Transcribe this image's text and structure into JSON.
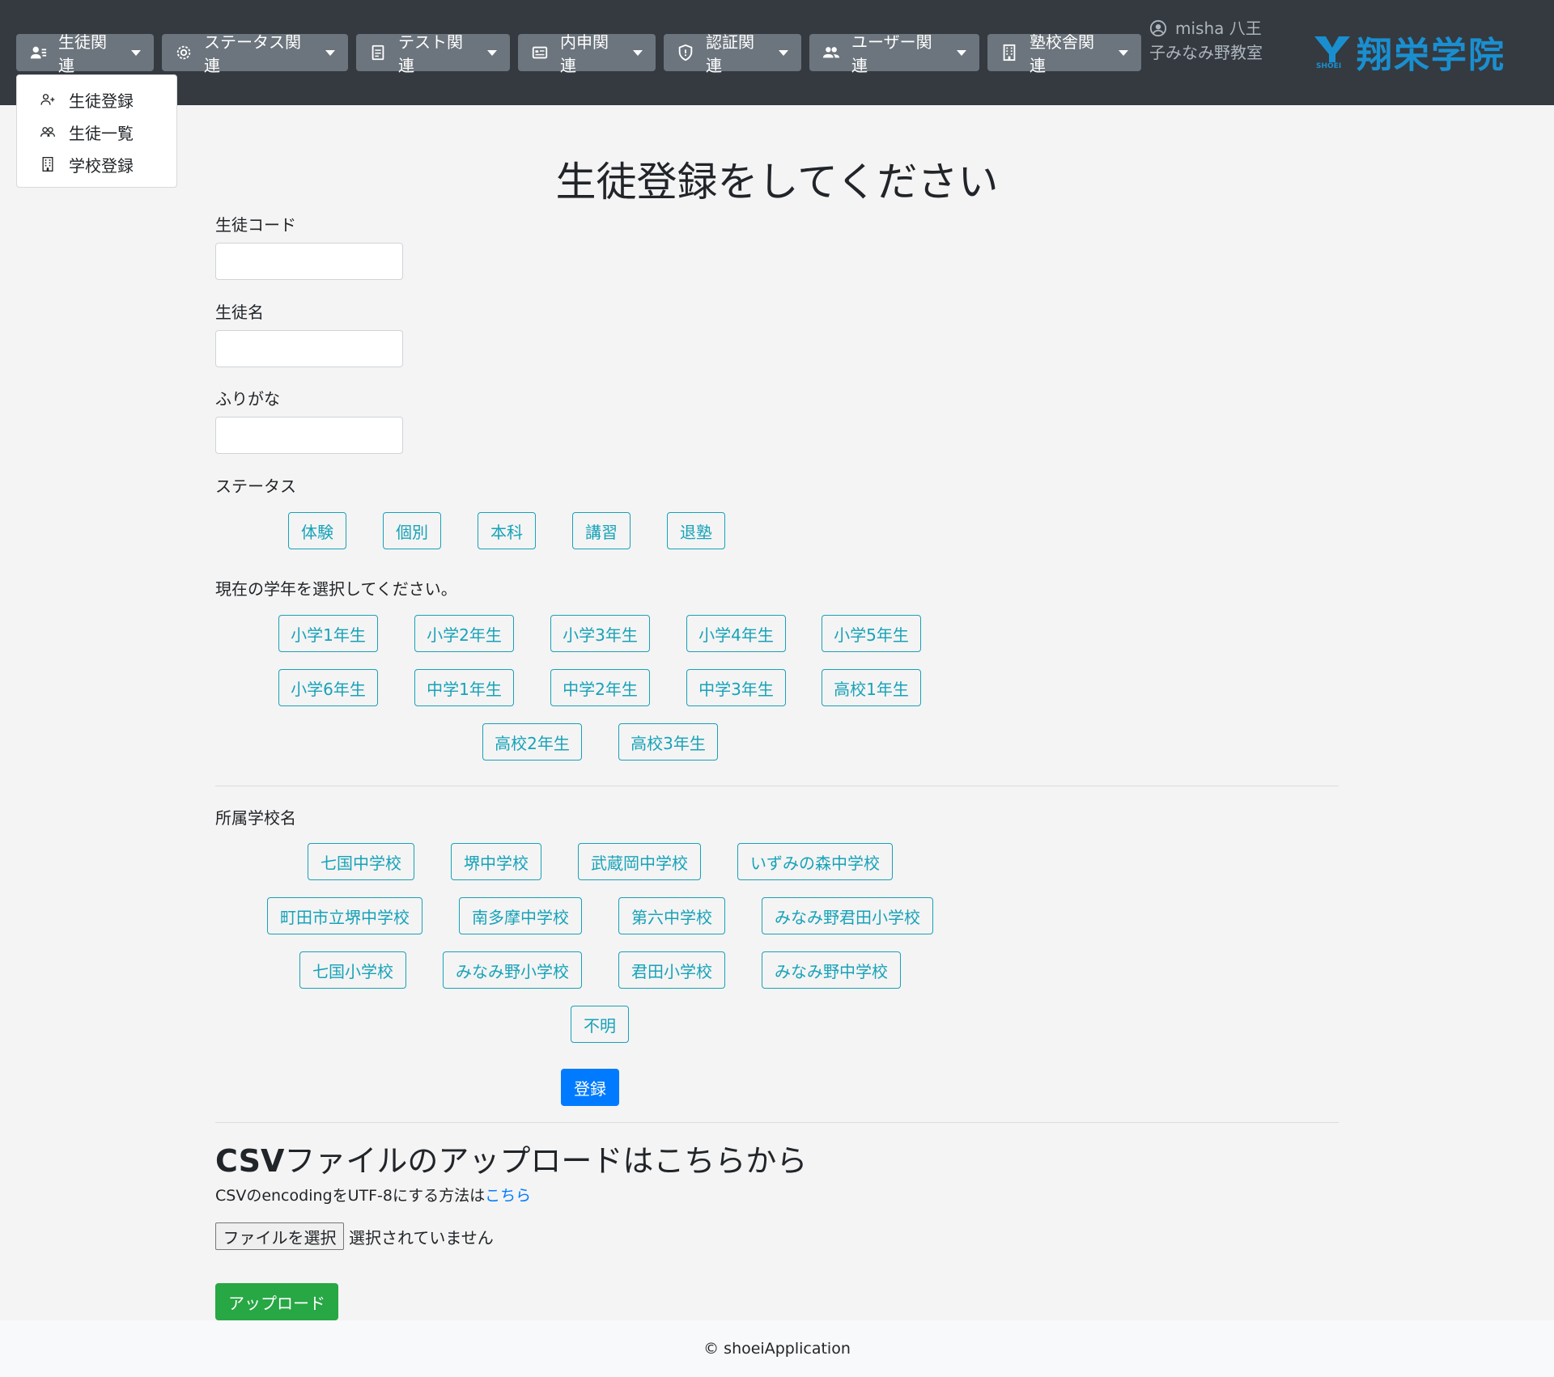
{
  "nav": {
    "items": [
      {
        "label": "生徒関連",
        "icon": "student-icon"
      },
      {
        "label": "ステータス関連",
        "icon": "gear-icon"
      },
      {
        "label": "テスト関連",
        "icon": "document-icon"
      },
      {
        "label": "内申関連",
        "icon": "card-icon"
      },
      {
        "label": "認証関連",
        "icon": "shield-icon"
      },
      {
        "label": "ユーザー関連",
        "icon": "users-icon"
      },
      {
        "label": "塾校舎関連",
        "icon": "building-icon"
      }
    ],
    "user_name": "misha",
    "user_location": "八王子みなみ野教室",
    "logo_text": "翔栄学院",
    "logo_sub": "SHOEI",
    "brand_color": "#1a8fd0"
  },
  "dropdown": {
    "items": [
      {
        "label": "生徒登録",
        "icon": "person-add-icon"
      },
      {
        "label": "生徒一覧",
        "icon": "people-icon"
      },
      {
        "label": "学校登録",
        "icon": "building-icon"
      }
    ]
  },
  "form": {
    "title": "生徒登録をしてください",
    "code_label": "生徒コード",
    "code_value": "",
    "name_label": "生徒名",
    "name_value": "",
    "kana_label": "ふりがな",
    "kana_value": "",
    "status_label": "ステータス",
    "statuses": [
      "体験",
      "個別",
      "本科",
      "講習",
      "退塾"
    ],
    "grade_label": "現在の学年を選択してください。",
    "grades": [
      "小学1年生",
      "小学2年生",
      "小学3年生",
      "小学4年生",
      "小学5年生",
      "小学6年生",
      "中学1年生",
      "中学2年生",
      "中学3年生",
      "高校1年生",
      "高校2年生",
      "高校3年生"
    ],
    "school_label": "所属学校名",
    "schools": [
      "七国中学校",
      "堺中学校",
      "武蔵岡中学校",
      "いずみの森中学校",
      "町田市立堺中学校",
      "南多摩中学校",
      "第六中学校",
      "みなみ野君田小学校",
      "七国小学校",
      "みなみ野小学校",
      "君田小学校",
      "みなみ野中学校",
      "不明"
    ],
    "submit_label": "登録"
  },
  "csv": {
    "title_bold": "CSV",
    "title_rest": "ファイルのアップロードはこちらから",
    "note_prefix": "CSVのencodingをUTF-8にする方法は",
    "note_link": "こちら",
    "file_button": "ファイルを選択",
    "file_status": "選択されていません",
    "upload_label": "アップロード"
  },
  "footer": {
    "text": "© shoeiApplication"
  },
  "colors": {
    "navbar": "#343a40",
    "nav_button": "#6c757d",
    "outline": "#17a2b8",
    "primary": "#007bff",
    "success": "#28a745"
  }
}
